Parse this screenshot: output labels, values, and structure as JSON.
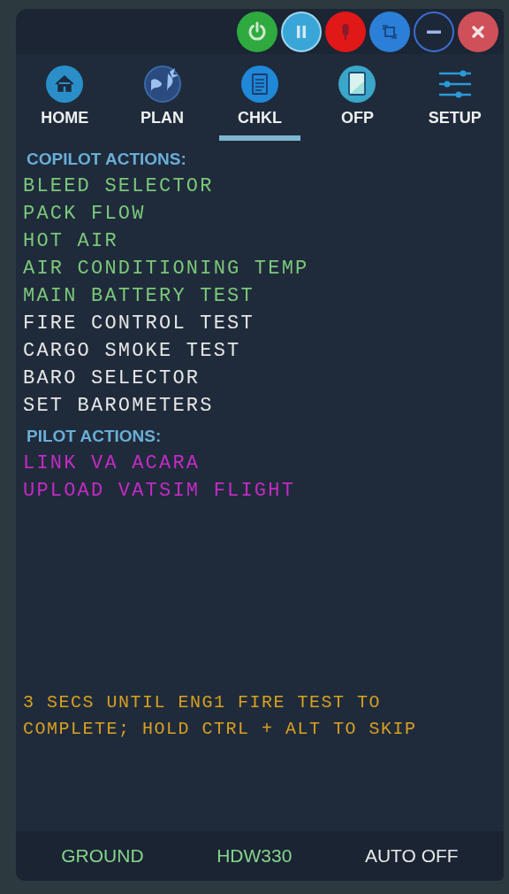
{
  "title_bar": {
    "buttons": [
      {
        "kind": "power"
      },
      {
        "kind": "pause"
      },
      {
        "kind": "mic"
      },
      {
        "kind": "restore"
      },
      {
        "kind": "minimize"
      },
      {
        "kind": "close"
      }
    ]
  },
  "tabs": [
    {
      "label": "HOME",
      "selected": false
    },
    {
      "label": "PLAN",
      "selected": false
    },
    {
      "label": "CHKL",
      "selected": true
    },
    {
      "label": "OFP",
      "selected": false
    },
    {
      "label": "SETUP",
      "selected": false
    }
  ],
  "sections": [
    {
      "heading": "COPILOT ACTIONS:",
      "items": [
        {
          "text": "BLEED SELECTOR",
          "color": "#7cc87a"
        },
        {
          "text": "PACK FLOW",
          "color": "#7cc87a"
        },
        {
          "text": "HOT AIR",
          "color": "#7cc87a"
        },
        {
          "text": "AIR CONDITIONING TEMP",
          "color": "#7cc87a"
        },
        {
          "text": "MAIN BATTERY TEST",
          "color": "#7cc87a"
        },
        {
          "text": "FIRE CONTROL TEST",
          "color": "#e6e6e6"
        },
        {
          "text": "CARGO SMOKE TEST",
          "color": "#e6e6e6"
        },
        {
          "text": "BARO SELECTOR",
          "color": "#e6e6e6"
        },
        {
          "text": "SET BAROMETERS",
          "color": "#e6e6e6"
        }
      ]
    },
    {
      "heading": "PILOT ACTIONS:",
      "items": [
        {
          "text": "LINK VA ACARA",
          "color": "#c42ac4"
        },
        {
          "text": "UPLOAD VATSIM FLIGHT",
          "color": "#c42ac4"
        }
      ]
    }
  ],
  "message": "3 SECS UNTIL ENG1 FIRE TEST TO COMPLETE; HOLD CTRL + ALT TO SKIP",
  "status_bar": [
    {
      "text": "GROUND",
      "color": "#86d48a"
    },
    {
      "text": "HDW330",
      "color": "#86d48a"
    },
    {
      "text": "AUTO OFF",
      "color": "#e8e8e8"
    }
  ]
}
